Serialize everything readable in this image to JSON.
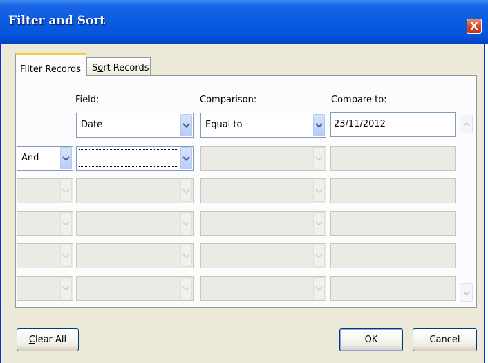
{
  "window": {
    "title": "Filter and Sort",
    "close_glyph": "X"
  },
  "tabs": [
    {
      "label": "Filter Records",
      "accel_before": "",
      "accel": "F",
      "accel_after": "ilter Records",
      "active": true
    },
    {
      "label": "Sort Records",
      "accel_before": "S",
      "accel": "o",
      "accel_after": "rt Records",
      "active": false
    }
  ],
  "headers": {
    "field": "Field:",
    "comparison": "Comparison:",
    "compare_to": "Compare to:"
  },
  "rows": [
    {
      "conjunction": "",
      "field": "Date",
      "comparison": "Equal to",
      "compare_to": "23/11/2012"
    },
    {
      "conjunction": "And",
      "field": "",
      "comparison": "",
      "compare_to": ""
    },
    {
      "conjunction": "",
      "field": "",
      "comparison": "",
      "compare_to": ""
    },
    {
      "conjunction": "",
      "field": "",
      "comparison": "",
      "compare_to": ""
    },
    {
      "conjunction": "",
      "field": "",
      "comparison": "",
      "compare_to": ""
    },
    {
      "conjunction": "",
      "field": "",
      "comparison": "",
      "compare_to": ""
    }
  ],
  "buttons": {
    "clear_all": {
      "label": "Clear All",
      "accel": "C",
      "rest": "lear All"
    },
    "ok": "OK",
    "cancel": "Cancel"
  },
  "icons": {
    "dropdown": "chevron-down-icon",
    "scroll_up": "scroll-up-icon",
    "scroll_down": "scroll-down-icon",
    "close": "close-icon"
  },
  "colors": {
    "titlebar": "#0a5ce0",
    "close": "#d3431e",
    "face": "#ece9d8",
    "active_tab_accent": "#ffc83c"
  }
}
